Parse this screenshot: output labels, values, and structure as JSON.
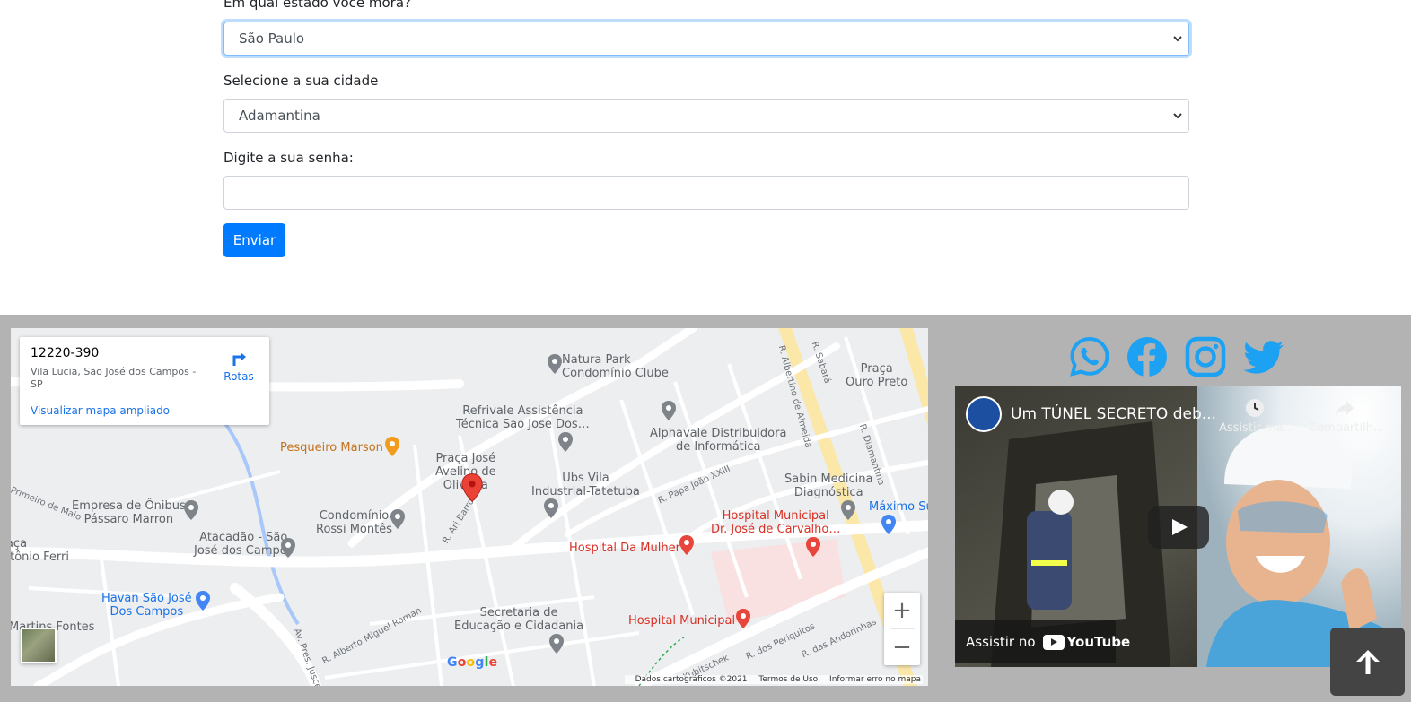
{
  "form": {
    "state_label": "Em qual estado você mora?",
    "state_value": "São Paulo",
    "city_label": "Selecione a sua cidade",
    "city_value": "Adamantina",
    "password_label": "Digite a sua senha:",
    "password_value": "",
    "submit_label": "Enviar"
  },
  "map": {
    "card": {
      "cep": "12220-390",
      "address": "Vila Lucia, São José dos Campos - SP",
      "directions_label": "Rotas",
      "view_larger_label": "Visualizar mapa ampliado"
    },
    "pois": {
      "natura": "Natura Park\nCondomínio Clube",
      "refrivale": "Refrivale Assistência\nTécnica Sao Jose Dos…",
      "alphavale": "Alphavale Distribuidora\nde Informática",
      "pesqueiro": "Pesqueiro Marson",
      "praca_jose": "Praça José\nAvelino de\nOliveira",
      "ubs": "Ubs Vila\nIndustrial-Tatetuba",
      "sabin": "Sabin Medicina\nDiagnóstica",
      "maximo": "Máximo Su",
      "praca_ouro": "Praça\nOuro Preto",
      "empresa": "Empresa de Ônibus\nPássaro Marron",
      "condominio": "Condomínio\nRossi Montês",
      "hosp_mun_dr": "Hospital Municipal\nDr. José de Carvalho…",
      "hosp_mulher": "Hospital Da Mulher",
      "atacadao": "Atacadão - São\nJosé dos Campos",
      "praca_ferri": "Praça\nAntônio Ferri",
      "havan": "Havan São José\nDos Campos",
      "secretaria": "Secretaria de\nEducação e Cidadania",
      "hosp_mun": "Hospital Municipal",
      "martins": "Martins Fontes"
    },
    "streets": {
      "sabara": "R. Sabará",
      "albertino": "R. Albertino de Almeida",
      "diamantina": "R. Diamantina",
      "papa": "R. Papa João XXIII",
      "ari": "R. Ari Barroso",
      "maio": "Primeiro de Maio",
      "miguel": "R. Alberto Miguel Roman",
      "pres": "Av. Pres. Juscelino",
      "kubitschek": "Kubitschek",
      "periquitos": "R. dos Periquitos",
      "andorinhas": "R. das Andorinhas"
    },
    "zoom_in": "+",
    "zoom_out": "−",
    "google": "Google",
    "attribution": {
      "data": "Dados cartográficos ©2021",
      "terms": "Termos de Uso",
      "report": "Informar erro no mapa"
    }
  },
  "social": [
    "whatsapp-icon",
    "facebook-icon",
    "instagram-icon",
    "twitter-icon"
  ],
  "video": {
    "title": "Um TÚNEL SECRETO deb...",
    "watch_later": "Assistir ma...",
    "share": "Compartilh...",
    "watch_on": "Assistir no",
    "youtube": "YouTube"
  },
  "colors": {
    "primary": "#007bff",
    "footer_bg": "#b3b3b3",
    "map_pin": "#ea4335",
    "social_blue": "#1da1f2"
  }
}
